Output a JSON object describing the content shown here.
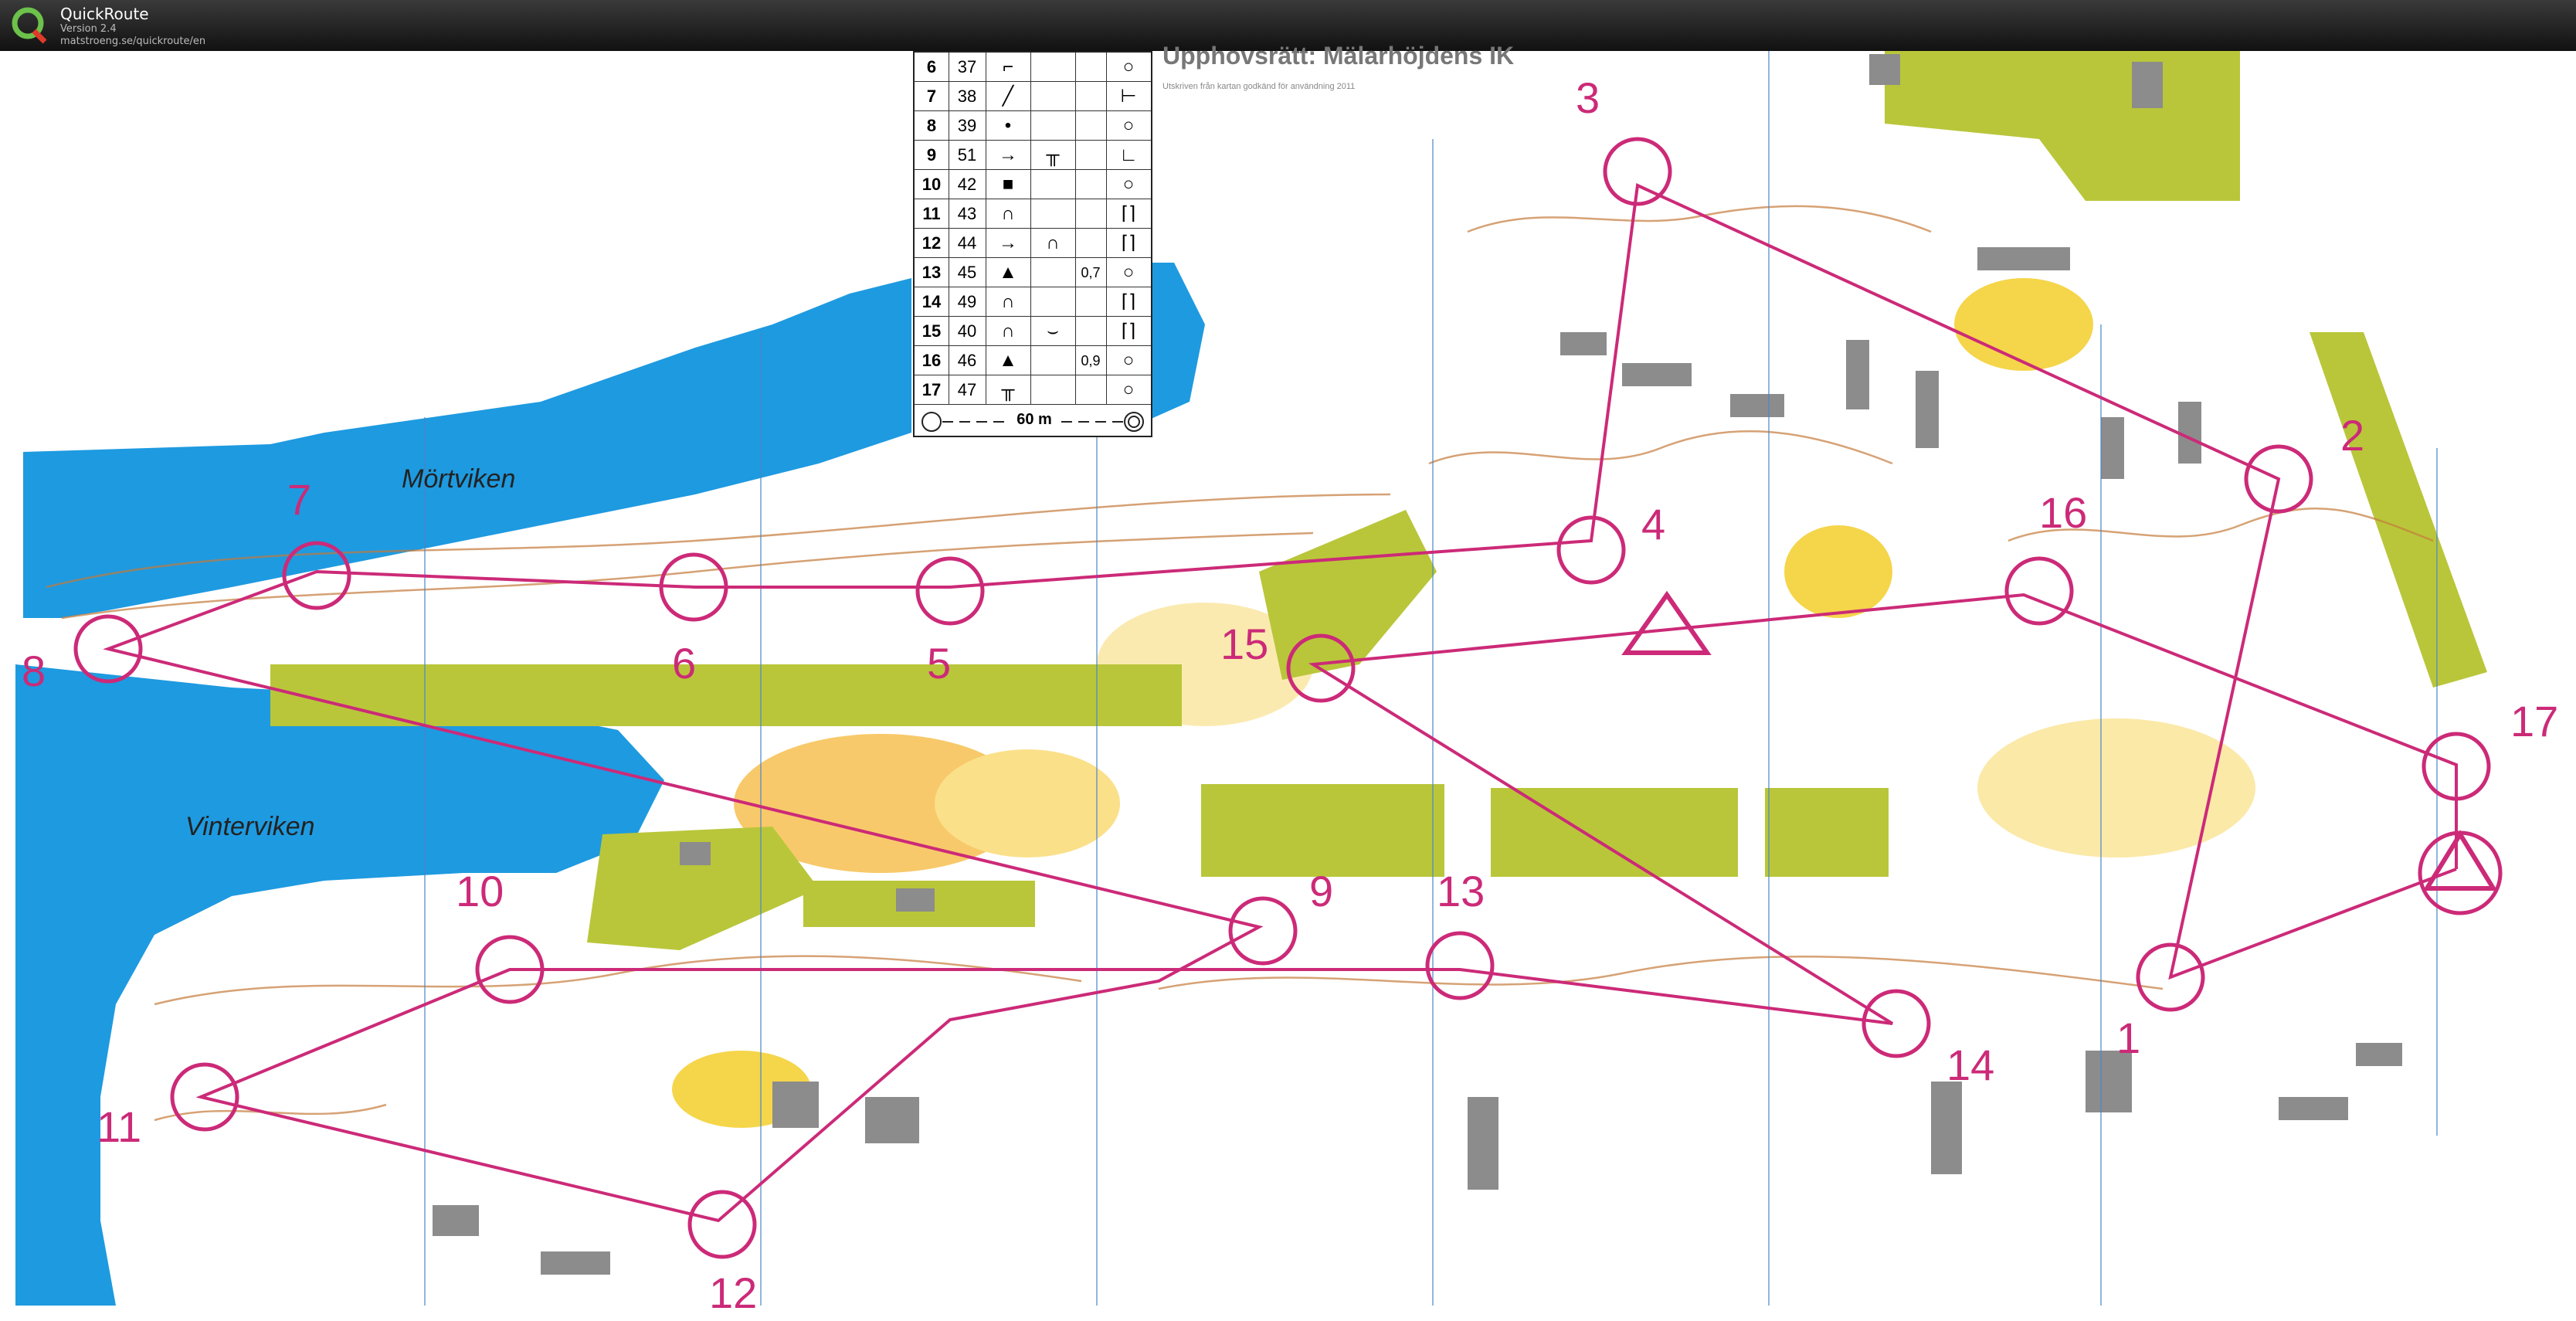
{
  "app": {
    "name": "QuickRoute",
    "version": "Version 2.4",
    "url": "matstroeng.se/quickroute/en",
    "logo_icon": "quickroute-q-logo",
    "accent": "#cc2a78"
  },
  "map": {
    "copyright_title": "Upphovsrätt: Mälarhöjdens IK",
    "copyright_subtitle": "Utskriven från kartan godkänd för användning 2011",
    "places": [
      "Mörtviken",
      "Vinterviken"
    ],
    "colors": {
      "water": "#1e9ae0",
      "yellow": "#f5d54a",
      "olive": "#b9c63a",
      "building": "#8c8c8c",
      "course": "#cc2a78",
      "contour": "#c47a3a"
    },
    "control_labels": [
      "1",
      "3",
      "4",
      "5",
      "6",
      "7",
      "8",
      "9",
      "10",
      "11",
      "12",
      "13",
      "14",
      "15",
      "16",
      "17",
      "2"
    ]
  },
  "control_descriptions": {
    "rows": [
      {
        "num": "6",
        "code": "37",
        "extra": ""
      },
      {
        "num": "7",
        "code": "38",
        "extra": ""
      },
      {
        "num": "8",
        "code": "39",
        "extra": ""
      },
      {
        "num": "9",
        "code": "51",
        "extra": ""
      },
      {
        "num": "10",
        "code": "42",
        "extra": ""
      },
      {
        "num": "11",
        "code": "43",
        "extra": ""
      },
      {
        "num": "12",
        "code": "44",
        "extra": ""
      },
      {
        "num": "13",
        "code": "45",
        "extra": "0,7"
      },
      {
        "num": "14",
        "code": "49",
        "extra": ""
      },
      {
        "num": "15",
        "code": "40",
        "extra": ""
      },
      {
        "num": "16",
        "code": "46",
        "extra": "0,9"
      },
      {
        "num": "17",
        "code": "47",
        "extra": ""
      }
    ],
    "finish_distance": "60 m"
  }
}
